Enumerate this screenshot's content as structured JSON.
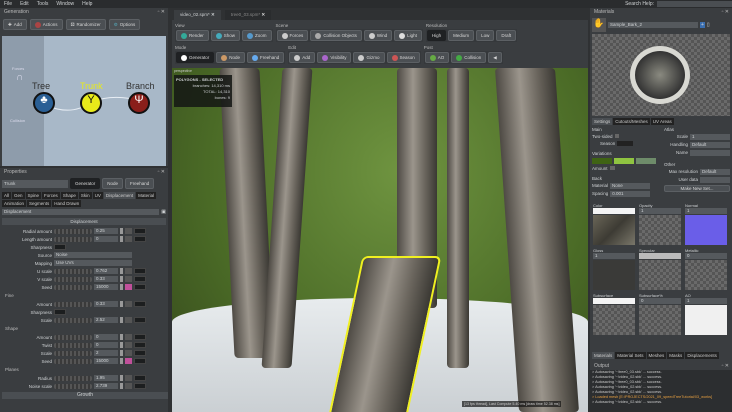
{
  "menu": [
    "File",
    "Edit",
    "Tools",
    "Window",
    "Help"
  ],
  "search": {
    "label": "Search Help:"
  },
  "generation": {
    "title": "Generation",
    "buttons": [
      "Add",
      "Actions",
      "Randomizer",
      "Options"
    ],
    "side": [
      "Forces",
      "Collision"
    ],
    "nodes": [
      {
        "label": "Tree",
        "color": "#2a5f95"
      },
      {
        "label": "Trunk",
        "color": "#e8ea1a"
      },
      {
        "label": "Branch",
        "color": "#8a1f1a"
      }
    ]
  },
  "properties": {
    "title": "Properties",
    "name": "Trunk",
    "modes": [
      "Generator",
      "Node",
      "Freehand"
    ],
    "tabs": [
      "All",
      "Gen",
      "Spine",
      "Forces",
      "Shape",
      "Skin",
      "UV",
      "Displacement",
      "Material",
      "Animation",
      "Segments",
      "Hand Drawn"
    ],
    "dropdown": "Displacement",
    "section": "Displacement",
    "rows": [
      {
        "n": "Radial amount",
        "v": "0.25"
      },
      {
        "n": "Length amount",
        "v": "0"
      }
    ],
    "sharpness": "Sharpness",
    "source": {
      "n": "Source",
      "v": "Noise"
    },
    "mapping": {
      "n": "Mapping",
      "v": "Use UVs"
    },
    "rows2": [
      {
        "n": "U scale",
        "v": "0.762"
      },
      {
        "n": "V scale",
        "v": "0.33"
      },
      {
        "n": "Seed",
        "v": "15000"
      }
    ],
    "fine": {
      "title": "Fine",
      "amount": {
        "n": "Amount",
        "v": "0.33"
      },
      "sharp": "Sharpness",
      "scale": {
        "n": "Scale",
        "v": "2.52"
      }
    },
    "shape": {
      "title": "Shape",
      "rows": [
        {
          "n": "Amount",
          "v": "0"
        },
        {
          "n": "Twist",
          "v": "0"
        },
        {
          "n": "Scale",
          "v": "2"
        },
        {
          "n": "Seed",
          "v": "15000"
        }
      ]
    },
    "planes": {
      "title": "Planes",
      "rows": [
        {
          "n": "Radius",
          "v": "1.95"
        },
        {
          "n": "Noise scale",
          "v": "2.739"
        }
      ]
    },
    "growth": "Growth"
  },
  "tabs": [
    {
      "label": "video_02.spm*"
    },
    {
      "label": "tree0_03.spm*"
    }
  ],
  "toolbar": {
    "view": {
      "label": "View",
      "buttons": [
        "Render",
        "Show",
        "Zoom"
      ]
    },
    "scene": {
      "label": "Scene",
      "buttons": [
        "Forces",
        "Collision Objects",
        "Wind",
        "Light"
      ]
    },
    "resolution": {
      "label": "Resolution",
      "buttons": [
        "High",
        "Medium",
        "Low",
        "Draft"
      ]
    },
    "mode": {
      "label": "Mode",
      "buttons": [
        "Generator",
        "Node",
        "Freehand"
      ]
    },
    "edit": {
      "label": "Edit",
      "buttons": [
        "Add",
        "Visibility",
        "Gizmo",
        "Season"
      ]
    },
    "post": {
      "label": "Post",
      "buttons": [
        "AO",
        "Collision"
      ]
    }
  },
  "viewport": {
    "camera": "perspective",
    "stats_title": "POLYGONS - SELECTED",
    "branches": "branches:  14,310 ms",
    "total": "TOTAL:  14,310",
    "bones": "bones:  9",
    "status": "[13 fps thread], Last Compute 5.40 ms [draw time 52.38 ms]"
  },
  "materials": {
    "title": "Materials",
    "selected": "Sample_Bark_2",
    "tabs": [
      "Settings",
      "Cutouts/Meshes",
      "UV Areas"
    ],
    "main": "Main",
    "two_sided": "Two-sided",
    "season": "Season",
    "variations": "Variations",
    "var_colors": [
      "#3f6314",
      "#8fc441",
      "#6e8c6a"
    ],
    "amount": "Amount",
    "back": "Back",
    "back_material": {
      "n": "Material",
      "v": "None"
    },
    "spacing": {
      "n": "Spacing",
      "v": "0.001"
    },
    "atlas": "Atlas",
    "scale": {
      "n": "Scale",
      "v": "1"
    },
    "handling": {
      "n": "Handling",
      "v": "Default"
    },
    "name": "Name",
    "other": "Other",
    "maxres": {
      "n": "Max resolution",
      "v": "Default"
    },
    "userdata": "User data",
    "make_new": "Make New Set...",
    "maps": [
      {
        "n": "Color",
        "v": ""
      },
      {
        "n": "Opacity",
        "v": "1"
      },
      {
        "n": "Normal",
        "v": "1"
      },
      {
        "n": "Gloss",
        "v": "1"
      },
      {
        "n": "Specular",
        "v": ""
      },
      {
        "n": "Metallic",
        "v": "0"
      },
      {
        "n": "Subsurface",
        "v": ""
      },
      {
        "n": "Subsurface%",
        "v": "0"
      },
      {
        "n": "AO",
        "v": "1"
      }
    ],
    "bottom_tabs": [
      "Materials",
      "Material Sets",
      "Meshes",
      "Masks",
      "Displacements"
    ]
  },
  "output": {
    "title": "Output",
    "lines": [
      "> Autosaving '~/tree0_03.sbk' ... success.",
      "> Autosaving '~/video_02.sbk' ... success.",
      "> Autosaving '~/tree0_03.sbk' ... success.",
      "> Autosaving '~/video_02.sbk' ... success.",
      "> Autosaving '~/video_02.sbk' ... success.",
      "> Loaded mesh [E:/PROJECTS/2021_09_speedTreeTutorial/03_works]",
      "> Autosaving '~/video_02.sbk' ... success."
    ]
  }
}
